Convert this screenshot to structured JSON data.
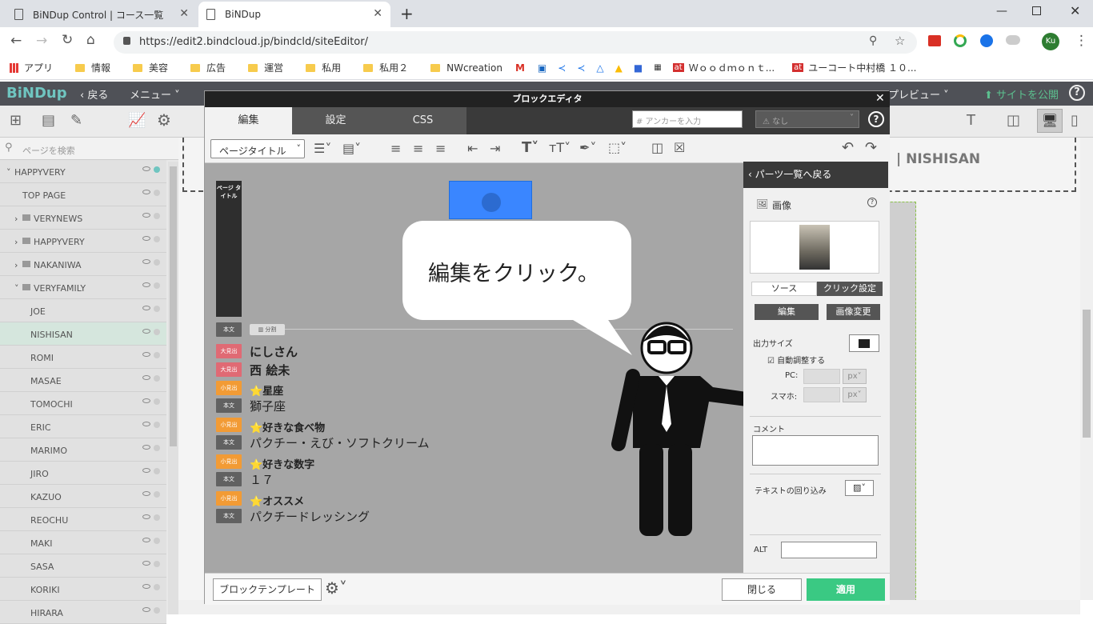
{
  "browser": {
    "tabs": [
      {
        "title": "BiNDup Control | コース一覧"
      },
      {
        "title": "BiNDup"
      }
    ],
    "url": "https://edit2.bindcloud.jp/bindcld/siteEditor/",
    "profile": "Ku",
    "bookmarks": [
      "アプリ",
      "情報",
      "美容",
      "広告",
      "運営",
      "私用",
      "私用２",
      "NWcreation",
      "Ｗｏｏｄｍｏｎｔ...",
      "ユーコート中村橋 １０..."
    ]
  },
  "app": {
    "logo": "BiNDup",
    "back": "戻る",
    "menu": "メニュー",
    "publish": "サイトを公開",
    "preview": "プレビュー",
    "nishisan_banner": "| NISHISAN",
    "search_placeholder": "ページを検索"
  },
  "sidebar": {
    "items": [
      {
        "label": "HAPPYVERY",
        "indent": 0,
        "arrow": "˅"
      },
      {
        "label": "TOP PAGE",
        "indent": 1,
        "arrow": ""
      },
      {
        "label": "VERYNEWS",
        "indent": 1,
        "arrow": "›",
        "folder": true
      },
      {
        "label": "HAPPYVERY",
        "indent": 1,
        "arrow": "›",
        "folder": true
      },
      {
        "label": "NAKANIWA",
        "indent": 1,
        "arrow": "›",
        "folder": true
      },
      {
        "label": "VERYFAMILY",
        "indent": 1,
        "arrow": "˅",
        "folder": true
      },
      {
        "label": "JOE",
        "indent": 2
      },
      {
        "label": "NISHISAN",
        "indent": 2,
        "selected": true
      },
      {
        "label": "ROMI",
        "indent": 2
      },
      {
        "label": "MASAE",
        "indent": 2
      },
      {
        "label": "TOMOCHI",
        "indent": 2
      },
      {
        "label": "ERIC",
        "indent": 2
      },
      {
        "label": "MARIMO",
        "indent": 2
      },
      {
        "label": "JIRO",
        "indent": 2
      },
      {
        "label": "KAZUO",
        "indent": 2
      },
      {
        "label": "REOCHU",
        "indent": 2
      },
      {
        "label": "MAKI",
        "indent": 2
      },
      {
        "label": "SASA",
        "indent": 2
      },
      {
        "label": "KORIKI",
        "indent": 2
      },
      {
        "label": "HIRARA",
        "indent": 2
      }
    ]
  },
  "modal": {
    "title": "ブロックエディタ",
    "tabs": [
      "編集",
      "設定",
      "CSS"
    ],
    "anchor_placeholder": "# アンカーを入力",
    "select_none": "なし",
    "page_title_select": "ページタイトル",
    "page_title_label": "ページ タイトル",
    "divider_label": "分割",
    "content": [
      {
        "tag": "大見出",
        "kind": "big",
        "text": "にしさん"
      },
      {
        "tag": "大見出",
        "kind": "big",
        "text": "西 絵未"
      },
      {
        "tag": "小見出",
        "kind": "small",
        "text": "⭐星座"
      },
      {
        "tag": "本文",
        "kind": "body",
        "text": "獅子座"
      },
      {
        "tag": "小見出",
        "kind": "small",
        "text": "⭐好きな食べ物"
      },
      {
        "tag": "本文",
        "kind": "body",
        "text": "パクチー・えび・ソフトクリーム"
      },
      {
        "tag": "小見出",
        "kind": "small",
        "text": "⭐好きな数字"
      },
      {
        "tag": "本文",
        "kind": "body",
        "text": "１７"
      },
      {
        "tag": "小見出",
        "kind": "small",
        "text": "⭐オススメ"
      },
      {
        "tag": "本文",
        "kind": "body",
        "text": "パクチードレッシング"
      }
    ],
    "body_tag_top": "本文",
    "callout": "編集をクリック。",
    "panel": {
      "back": "パーツ一覧へ戻る",
      "image_title": "画像",
      "source_tab": "ソース",
      "click_tab": "クリック設定",
      "edit": "編集",
      "change": "画像変更",
      "output_size": "出力サイズ",
      "auto": "自動調整する",
      "pc": "PC:",
      "phone": "スマホ:",
      "unit": "px",
      "comment": "コメント",
      "wrap": "テキストの回り込み",
      "alt": "ALT"
    },
    "footer": {
      "template": "ブロックテンプレート",
      "close": "閉じる",
      "apply": "適用"
    }
  }
}
